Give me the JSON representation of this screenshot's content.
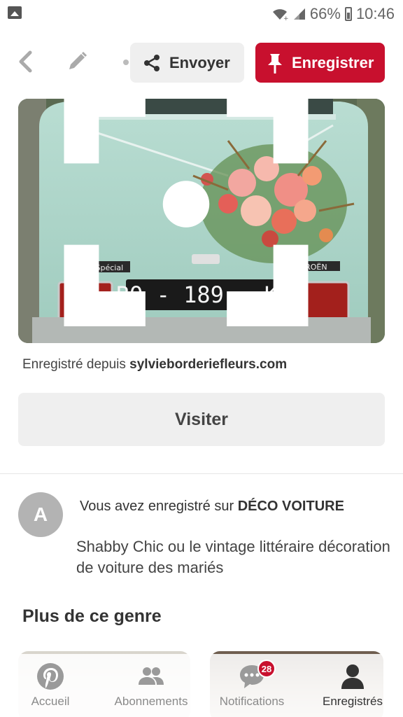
{
  "status_bar": {
    "battery": "66%",
    "time": "10:46"
  },
  "toolbar": {
    "send_label": "Envoyer",
    "save_label": "Enregistrer"
  },
  "pin": {
    "image_text": {
      "plate": "BQ - 189 - KZ",
      "model_badge": "2CV6 Spécial",
      "brand_badge": "CITROËN"
    },
    "saved_from_prefix": "Enregistré depuis",
    "saved_from_domain": "sylvieborderiefleurs.com",
    "visit_label": "Visiter"
  },
  "board": {
    "avatar_letter": "A",
    "saved_on_prefix": "Vous avez enregistré sur",
    "board_name": "DÉCO VOITURE",
    "description": "Shabby Chic ou le vintage littéraire décoration de voiture des mariés"
  },
  "more": {
    "title": "Plus de ce genre"
  },
  "bottom_nav": {
    "items": [
      {
        "label": "Accueil",
        "icon": "pinterest-icon"
      },
      {
        "label": "Abonnements",
        "icon": "people-icon"
      },
      {
        "label": "Notifications",
        "icon": "chat-bubble-icon",
        "badge": "28"
      },
      {
        "label": "Enregistrés",
        "icon": "profile-icon"
      }
    ]
  },
  "colors": {
    "accent": "#c8102e",
    "button_gray": "#efefef"
  }
}
